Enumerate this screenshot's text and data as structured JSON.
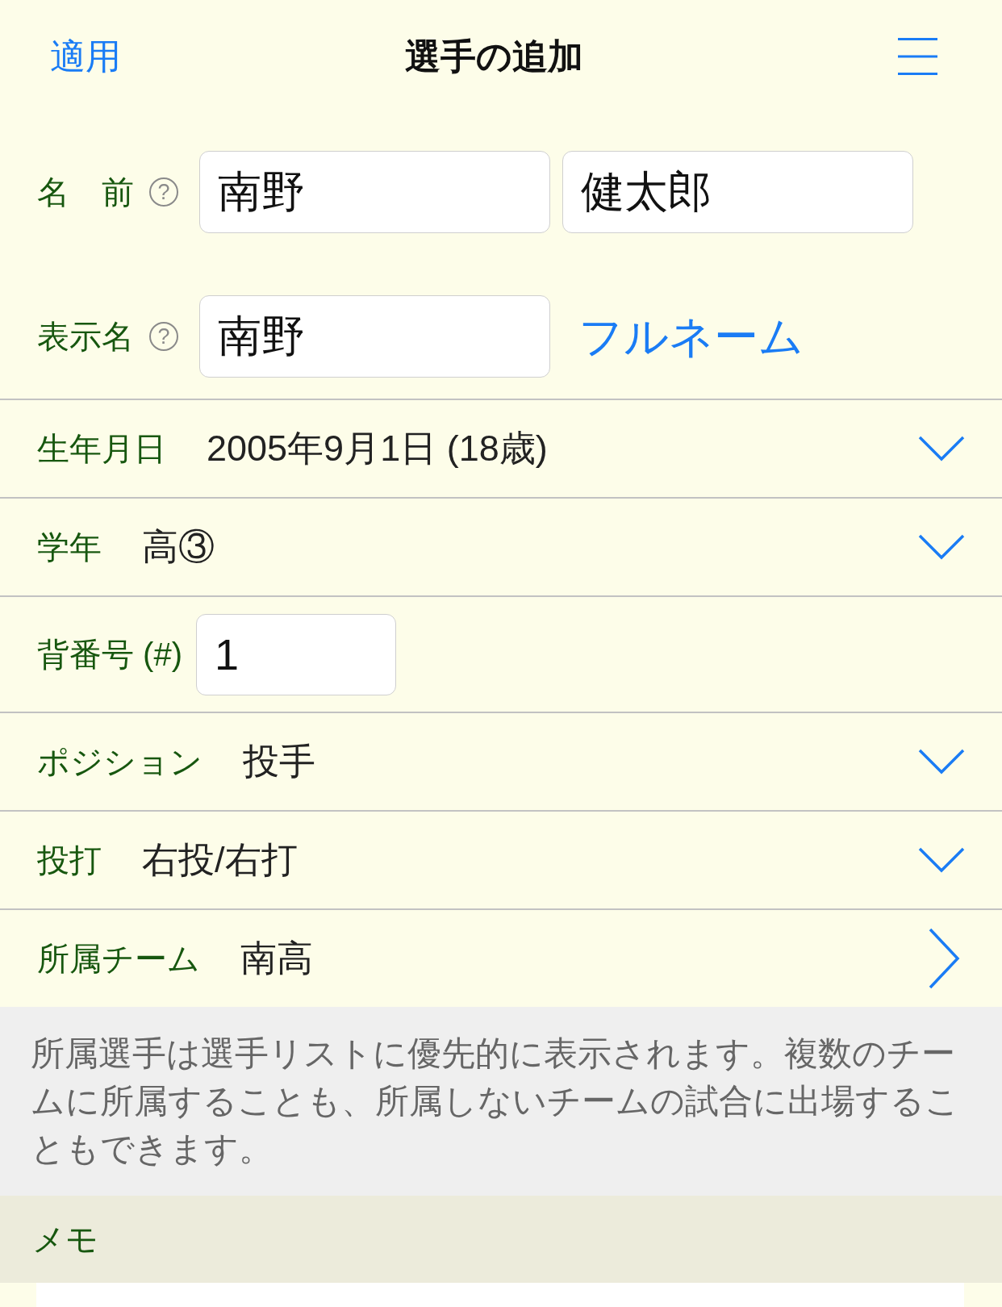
{
  "header": {
    "apply": "適用",
    "title": "選手の追加"
  },
  "name": {
    "label": "名　前",
    "help": "?",
    "last_name": "南野",
    "first_name": "健太郎"
  },
  "display_name": {
    "label": "表示名",
    "help": "?",
    "value": "南野",
    "full_name_link": "フルネーム"
  },
  "rows": [
    {
      "kind": "select",
      "label": "生年月日",
      "value": "2005年9月1日 (18歳)"
    },
    {
      "kind": "select",
      "label": "学年",
      "value": "高③"
    },
    {
      "kind": "input",
      "label": "背番号 (#)",
      "value": "1"
    },
    {
      "kind": "select",
      "label": "ポジション",
      "value": "投手"
    },
    {
      "kind": "select",
      "label": "投打",
      "value": "右投/右打"
    },
    {
      "kind": "link",
      "label": "所属チーム",
      "value": "南高"
    }
  ],
  "team_note": "所属選手は選手リストに優先的に表示されます。複数のチームに所属することも、所属しないチームの試合に出場することもできます。",
  "memo": {
    "label": "メモ"
  }
}
